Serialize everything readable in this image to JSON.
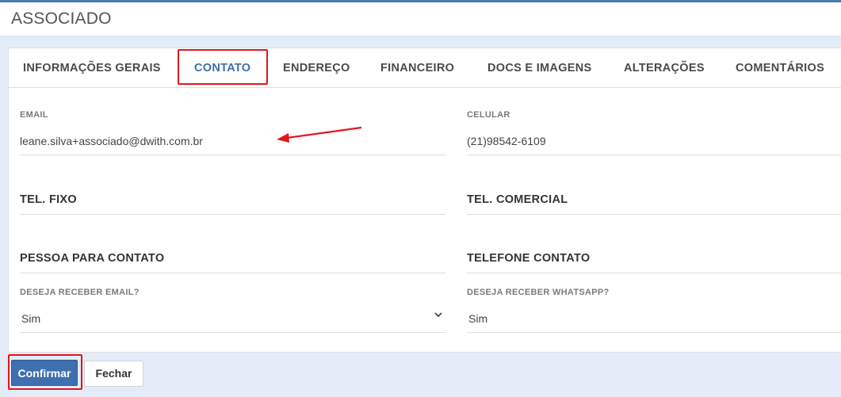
{
  "header": {
    "title": "ASSOCIADO"
  },
  "tabs": [
    {
      "label": "INFORMAÇÕES GERAIS"
    },
    {
      "label": "CONTATO"
    },
    {
      "label": "ENDEREÇO"
    },
    {
      "label": "FINANCEIRO"
    },
    {
      "label": "DOCS E IMAGENS"
    },
    {
      "label": "ALTERAÇÕES"
    },
    {
      "label": "COMENTÁRIOS"
    }
  ],
  "active_tab": "CONTATO",
  "form": {
    "email": {
      "label": "EMAIL",
      "value": "leane.silva+associado@dwith.com.br"
    },
    "celular": {
      "label": "CELULAR",
      "value": "(21)98542-6109"
    },
    "tel_fixo": {
      "label": "TEL. FIXO"
    },
    "tel_comercial": {
      "label": "TEL. COMERCIAL"
    },
    "pessoa_contato": {
      "label": "PESSOA PARA CONTATO"
    },
    "telefone_contato": {
      "label": "TELEFONE CONTATO"
    },
    "receber_email": {
      "label": "DESEJA RECEBER EMAIL?",
      "value": "Sim"
    },
    "receber_whatsapp": {
      "label": "DESEJA RECEBER WHATSAPP?",
      "value": "Sim"
    }
  },
  "actions": {
    "confirm": "Confirmar",
    "close": "Fechar"
  },
  "icons": {
    "select_caret": "chevron-down-icon",
    "annotation": "red-arrow"
  },
  "colors": {
    "accent": "#3f6fae",
    "highlight": "#e3161b",
    "background": "#e4ecf7"
  }
}
